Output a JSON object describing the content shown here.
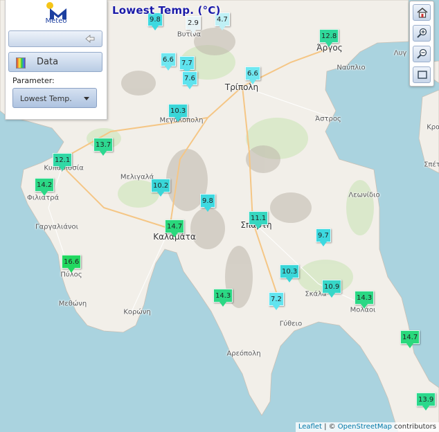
{
  "title": "Lowest Temp. (°C)",
  "logo": {
    "text": "Meteo"
  },
  "panel": {
    "data_label": "Data",
    "parameter_label": "Parameter:",
    "selected_parameter": "Lowest Temp."
  },
  "attribution": {
    "leaflet": "Leaflet",
    "separator": " | © ",
    "osm": "OpenStreetMap",
    "suffix": " contributors"
  },
  "places": [
    {
      "name": "Βυτίνα",
      "size": "small"
    },
    {
      "name": "Άργος",
      "size": "big"
    },
    {
      "name": "Ναύπλιο",
      "size": "small"
    },
    {
      "name": "Λυγ",
      "size": "small"
    },
    {
      "name": "Τρίπολη",
      "size": "big"
    },
    {
      "name": "Μεγαλόπολη",
      "size": "small"
    },
    {
      "name": "Άστρος",
      "size": "small"
    },
    {
      "name": "Κρα",
      "size": "small"
    },
    {
      "name": "Σπέτ",
      "size": "small"
    },
    {
      "name": "Κυπαρισσία",
      "size": "small"
    },
    {
      "name": "Μελιγαλά",
      "size": "small"
    },
    {
      "name": "Φιλιατρά",
      "size": "small"
    },
    {
      "name": "Λεωνίδιο",
      "size": "small"
    },
    {
      "name": "Γαργαλιάνοι",
      "size": "small"
    },
    {
      "name": "Σπάρτη",
      "size": "big"
    },
    {
      "name": "Καλαμάτα",
      "size": "big"
    },
    {
      "name": "Πύλος",
      "size": "small"
    },
    {
      "name": "Μεθώνη",
      "size": "small"
    },
    {
      "name": "Κορώνη",
      "size": "small"
    },
    {
      "name": "Σκάλα",
      "size": "small"
    },
    {
      "name": "Μολάοι",
      "size": "small"
    },
    {
      "name": "Γύθειο",
      "size": "small"
    },
    {
      "name": "Αρεόπολη",
      "size": "small"
    }
  ],
  "stations": [
    {
      "value": "9.8",
      "color": "#3dd9e0"
    },
    {
      "value": "2.9",
      "color": "#e8f4f6"
    },
    {
      "value": "4.7",
      "color": "#bff0f5"
    },
    {
      "value": "12.8",
      "color": "#2fd89a"
    },
    {
      "value": "6.6",
      "color": "#6fe7f0"
    },
    {
      "value": "7.7",
      "color": "#5ee3ee"
    },
    {
      "value": "7.6",
      "color": "#5ee3ee"
    },
    {
      "value": "6.6",
      "color": "#6fe7f0"
    },
    {
      "value": "10.3",
      "color": "#3ad6d8"
    },
    {
      "value": "13.7",
      "color": "#2dd890"
    },
    {
      "value": "12.1",
      "color": "#31d8a5"
    },
    {
      "value": "14.2",
      "color": "#2bd886"
    },
    {
      "value": "10.2",
      "color": "#3ad6d8"
    },
    {
      "value": "9.8",
      "color": "#3dd9e0"
    },
    {
      "value": "11.1",
      "color": "#36d7c0"
    },
    {
      "value": "14.7",
      "color": "#2ad87c"
    },
    {
      "value": "9.7",
      "color": "#3dd9e0"
    },
    {
      "value": "16.6",
      "color": "#22d860"
    },
    {
      "value": "10.3",
      "color": "#3ad6d8"
    },
    {
      "value": "10.9",
      "color": "#37d7c8"
    },
    {
      "value": "14.3",
      "color": "#2bd884"
    },
    {
      "value": "14.3",
      "color": "#2bd884"
    },
    {
      "value": "7.2",
      "color": "#62e4ef"
    },
    {
      "value": "14.7",
      "color": "#2ad87c"
    },
    {
      "value": "13.9",
      "color": "#2cd88c"
    }
  ]
}
